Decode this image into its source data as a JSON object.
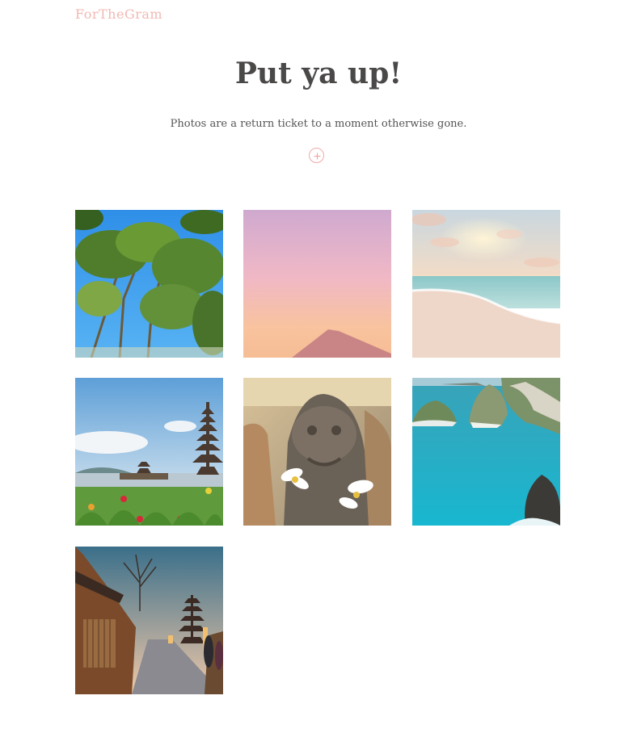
{
  "brand": {
    "name": "ForTheGram"
  },
  "hero": {
    "title": "Put ya up!",
    "subtitle": "Photos are a return ticket to a moment otherwise gone."
  },
  "add_button": {
    "icon": "plus-circle-icon",
    "color": "#f1a8a8"
  },
  "colors": {
    "brand": "#f2b8b2",
    "title": "#4b4848",
    "text": "#555555"
  },
  "gallery": {
    "photos": [
      {
        "subject": "tropical trees against blue sky"
      },
      {
        "subject": "pink sunset over volcano"
      },
      {
        "subject": "sunset beach with waves"
      },
      {
        "subject": "lake temple with pagoda towers"
      },
      {
        "subject": "stone carving with white flowers"
      },
      {
        "subject": "turquoise bay with rock cliffs"
      },
      {
        "subject": "old street with pagoda at dusk"
      }
    ]
  }
}
